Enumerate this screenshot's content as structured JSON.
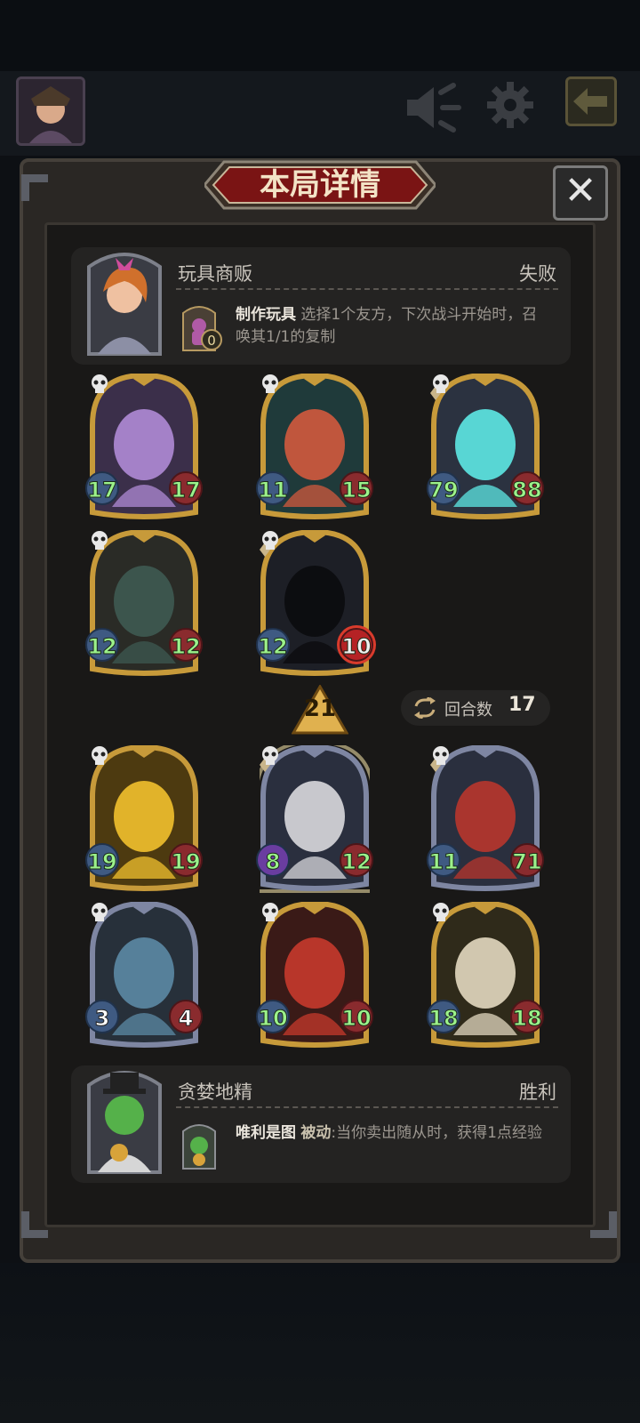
{
  "header": {
    "title": "本局详情",
    "close_label": "✕"
  },
  "opponent": {
    "name": "玩具商贩",
    "result": "失败",
    "skill_name": "制作玩具",
    "skill_desc": "选择1个友方，下次战斗开始时，召唤其1/1的复制",
    "skill_badge": "0"
  },
  "opponent_board": [
    {
      "attack": "17",
      "health": "17",
      "art": "masked-sorceress"
    },
    {
      "attack": "11",
      "health": "15",
      "art": "red-haired-witch"
    },
    {
      "attack": "79",
      "health": "88",
      "art": "cyan-ghost"
    },
    {
      "attack": "12",
      "health": "12",
      "art": "mimic-chest"
    },
    {
      "attack": "12",
      "health": "10",
      "art": "hooded-reaper"
    }
  ],
  "turn_marker": "21",
  "round": {
    "label": "回合数",
    "value": "17"
  },
  "player_board": [
    {
      "attack": "19",
      "health": "19",
      "art": "golden-dragon"
    },
    {
      "attack": "8",
      "health": "12",
      "art": "bone-dragon"
    },
    {
      "attack": "11",
      "health": "71",
      "art": "red-serpent-dragon"
    },
    {
      "attack": "3",
      "health": "4",
      "art": "winged-gargoyle"
    },
    {
      "attack": "10",
      "health": "10",
      "art": "red-demon-brute"
    },
    {
      "attack": "18",
      "health": "18",
      "art": "golden-dragon-priest"
    }
  ],
  "player": {
    "name": "贪婪地精",
    "result": "胜利",
    "skill_name": "唯利是图",
    "skill_keyword": "被动",
    "skill_desc": ":当你卖出随从时，获得1点经验"
  },
  "colors": {
    "attack_text": "#9cf28b",
    "gold_frame": "#c79a3a",
    "silver_frame": "#7e86a2",
    "title_red": "#7a1414"
  },
  "icons": [
    "speaker-icon",
    "gear-icon",
    "back-arrow-icon",
    "close-icon",
    "skull-icon",
    "turn-arrow-icon",
    "round-cycle-icon"
  ]
}
